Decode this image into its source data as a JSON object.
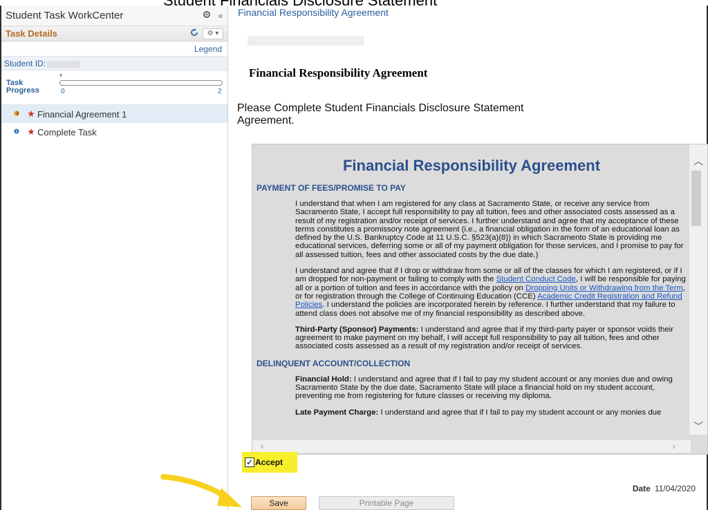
{
  "top_header_fragment": "Student Financials Disclosure Statement",
  "sidebar": {
    "title": "Student Task WorkCenter",
    "task_details_label": "Task Details",
    "legend_link": "Legend",
    "student_id_label": "Student ID:",
    "task_progress_label": "Task Progress",
    "progress_min": "0",
    "progress_max": "2",
    "tasks": [
      {
        "label": "Financial Agreement 1",
        "status_color": "#e0a21a",
        "active": true
      },
      {
        "label": "Complete Task",
        "status_color": "#2b6cc4",
        "active": false
      }
    ]
  },
  "main": {
    "breadcrumb": "Financial Responsibility Agreement",
    "heading": "Financial Responsibility Agreement",
    "instruction": "Please Complete Student Financials Disclosure Statement Agreement.",
    "accept_label": "Accept",
    "accept_checked": true,
    "date_label": "Date",
    "date_value": "11/04/2020",
    "save_label": "Save",
    "printable_label": "Printable Page"
  },
  "document": {
    "title": "Financial Responsibility Agreement",
    "section1_heading": "PAYMENT OF FEES/PROMISE TO PAY",
    "p1": "I understand that when I am registered for any class at Sacramento State, or receive any service from Sacramento State, I accept full responsibility to pay all tuition, fees and other associated costs assessed as a result of my registration and/or receipt of services. I further understand and agree that my acceptance of these terms constitutes a promissory note agreement (i.e., a financial obligation in the form of an educational loan as defined by the U.S. Bankruptcy Code at 11 U.S.C. §523(a)(8)) in which Sacramento State is providing me educational services, deferring some or all of my payment obligation for those services, and I promise to pay for all assessed tuition, fees and other associated costs by the due date.)",
    "p2_a": "I understand and agree that if I drop or withdraw from some or all of the classes for which I am registered, or if I am dropped for non-payment or failing to comply with the ",
    "p2_link1": "Student Conduct Code",
    "p2_b": ", I will be responsible for paying all or a portion of tuition and fees in accordance with the policy on ",
    "p2_link2": "Dropping Units or Withdrawing from the Term",
    "p2_c": ", or for registration through the College of Continuing Education (CCE) ",
    "p2_link3": "Academic Credit Registration and Refund Policies",
    "p2_d": ". I understand the policies are incorporated herein by reference. I further understand that my failure to attend class does not absolve me of my financial responsibility as described above.",
    "p3_bold": "Third-Party (Sponsor) Payments:",
    "p3": "  I understand and agree that if my third-party payer or sponsor voids their agreement to make payment on my behalf, I will accept full responsibility to pay all tuition, fees and other associated costs assessed as a result of my registration and/or receipt of services.",
    "section2_heading": "DELINQUENT ACCOUNT/COLLECTION",
    "p4_bold": "Financial Hold:",
    "p4": " I understand and agree that if I fail to pay my student account or any monies due and owing Sacramento State by the due date, Sacramento State will place a financial hold on my student account, preventing me from registering for future classes or receiving my diploma.",
    "p5_bold": "Late Payment Charge:",
    "p5": " I understand and agree that if I fail to pay my student account or any monies due"
  }
}
